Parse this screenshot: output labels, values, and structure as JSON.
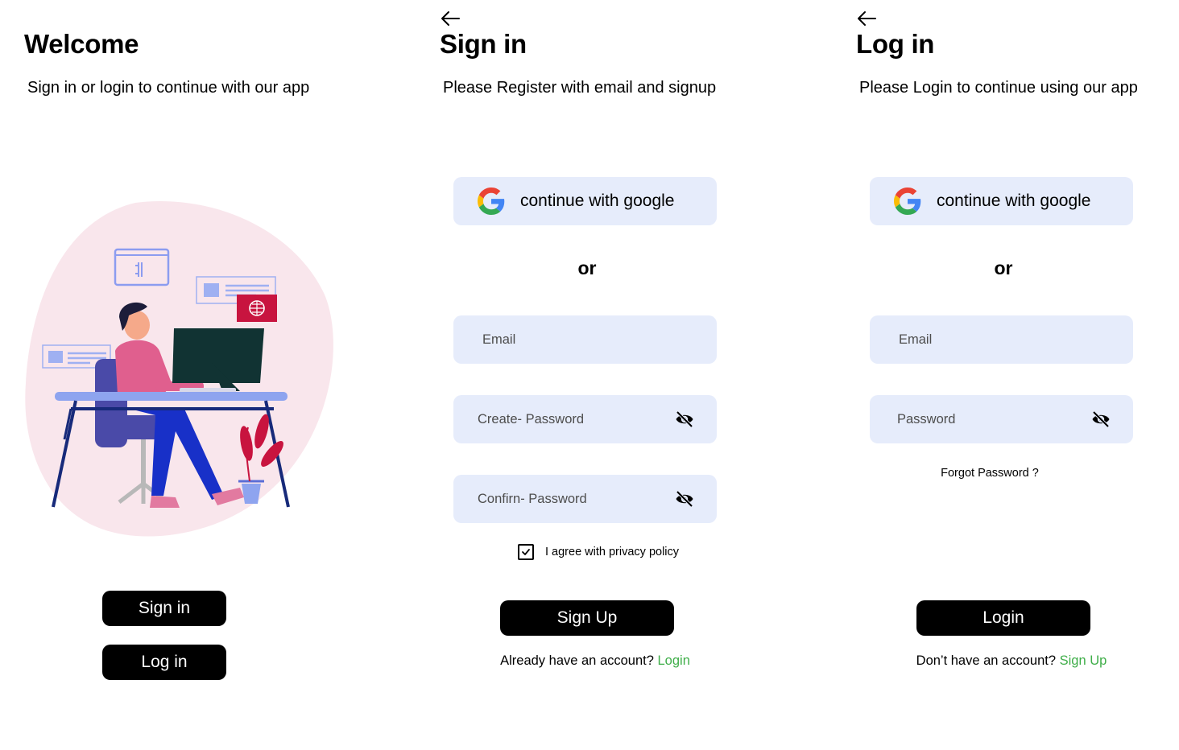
{
  "welcome": {
    "title": "Welcome",
    "subtitle": "Sign in or login to continue with our app",
    "signin_button": "Sign in",
    "login_button": "Log in"
  },
  "signin": {
    "back_icon": "arrow-left-icon",
    "title": "Sign in",
    "subtitle": "Please Register with email and signup",
    "google_button": "continue with google",
    "or_text": "or",
    "email_placeholder": "Email",
    "create_password_placeholder": "Create- Password",
    "confirm_password_placeholder": "Confirn- Password",
    "agree_checked": true,
    "agree_text": "I agree with privacy policy",
    "signup_button": "Sign Up",
    "footer_text": "Already have an account? ",
    "footer_link": "Login"
  },
  "login": {
    "back_icon": "arrow-left-icon",
    "title": "Log in",
    "subtitle": "Please Login to continue using our app",
    "google_button": "continue with google",
    "or_text": "or",
    "email_placeholder": "Email",
    "password_placeholder": "Password",
    "forgot_password": "Forgot Password ?",
    "login_button": "Login",
    "footer_text": "Don’t have an account? ",
    "footer_link": "Sign Up"
  },
  "colors": {
    "field_bg": "#e6ecfb",
    "button_bg": "#000000",
    "link_green": "#3fae49",
    "blob_pink": "#f9e6ec"
  }
}
